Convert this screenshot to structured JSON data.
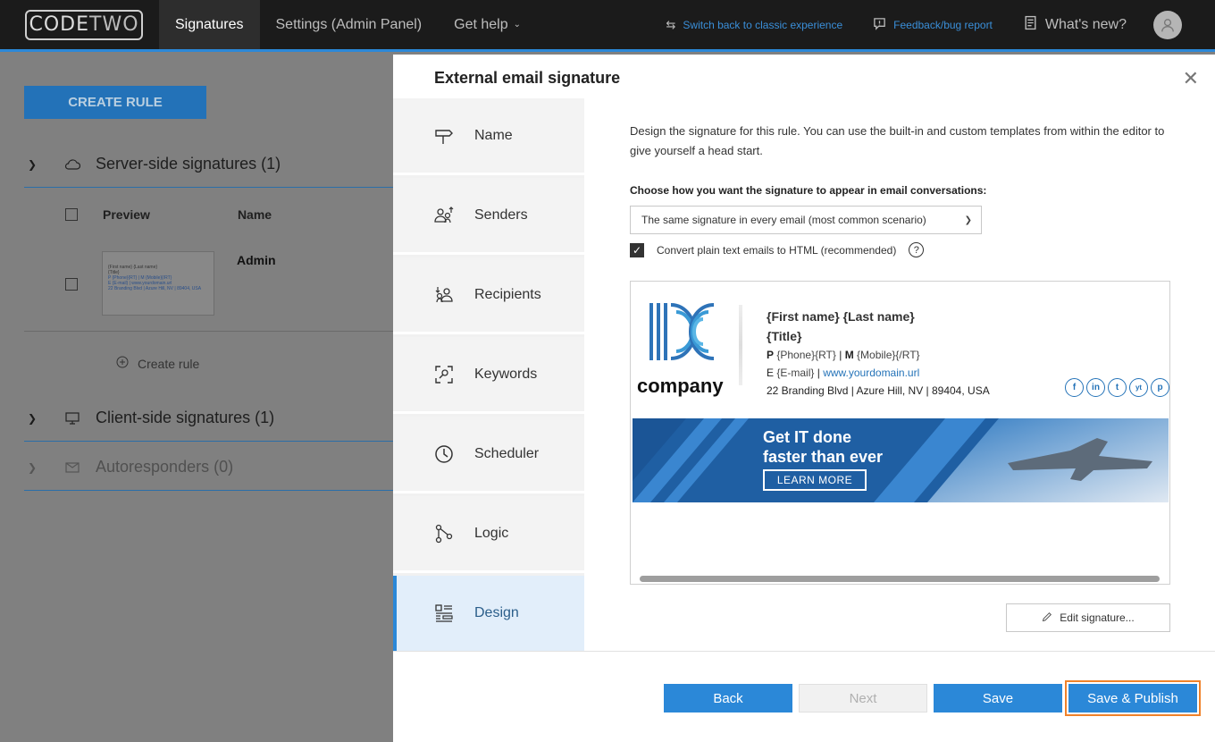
{
  "topbar": {
    "logo_code": "CODE",
    "logo_two": "TWO",
    "nav": [
      {
        "label": "Signatures",
        "active": true
      },
      {
        "label": "Settings (Admin Panel)",
        "active": false
      },
      {
        "label": "Get help",
        "active": false
      }
    ],
    "switch_classic": "Switch back to classic experience",
    "feedback": "Feedback/bug report",
    "whats_new": "What's new?"
  },
  "background": {
    "create_rule_button": "CREATE RULE",
    "sections": [
      {
        "title": "Server-side signatures (1)",
        "expanded": true
      },
      {
        "title": "Client-side signatures (1)",
        "expanded": false
      },
      {
        "title": "Autoresponders (0)",
        "expanded": false
      }
    ],
    "table_headers": {
      "preview": "Preview",
      "name": "Name"
    },
    "row": {
      "name": "Admin",
      "thumb_lines": [
        "{First name} {Last name}",
        "{Title}",
        "P {Phone}{RT} | M {Mobile}{/RT}",
        "E {E-mail} | www.yourdomain.url",
        "22 Branding Blvd | Azure Hill, NV | 89404, USA"
      ]
    },
    "create_rule_link": "Create rule"
  },
  "panel": {
    "title": "External email signature",
    "steps": [
      {
        "label": "Name",
        "icon": "signpost-icon"
      },
      {
        "label": "Senders",
        "icon": "senders-icon"
      },
      {
        "label": "Recipients",
        "icon": "recipients-icon"
      },
      {
        "label": "Keywords",
        "icon": "keywords-icon"
      },
      {
        "label": "Scheduler",
        "icon": "clock-icon"
      },
      {
        "label": "Logic",
        "icon": "logic-icon"
      },
      {
        "label": "Design",
        "icon": "design-icon"
      }
    ],
    "active_step": "Design",
    "intro": "Design the signature for this rule. You can use the built-in and custom templates from within the editor to give yourself a head start.",
    "choose_label": "Choose how you want the signature to appear in email conversations:",
    "select_value": "The same signature in every email (most common scenario)",
    "convert_label": "Convert plain text emails to HTML (recommended)",
    "convert_checked": true,
    "help_glyph": "?",
    "signature": {
      "company": "company",
      "name_line": "{First name} {Last name}",
      "title_line": "{Title}",
      "phone_p": "P",
      "phone_value": "{Phone}{RT}",
      "sep1": "|",
      "mobile_m": "M",
      "mobile_value": "{Mobile}{/RT}",
      "email_e": "E",
      "email_value": "{E-mail}",
      "sep2": "|",
      "url": "www.yourdomain.url",
      "address": "22 Branding Blvd | Azure Hill, NV | 89404, USA",
      "socials": [
        "f",
        "in",
        "t",
        "yt",
        "p"
      ],
      "banner_line1": "Get IT done",
      "banner_line2": "faster than ever",
      "banner_button": "LEARN MORE"
    },
    "edit_signature": "Edit signature...",
    "buttons": {
      "back": "Back",
      "next": "Next",
      "save": "Save",
      "save_publish": "Save & Publish"
    }
  },
  "colors": {
    "accent": "#2b88d8",
    "highlight": "#f0822a",
    "topbar": "#1b1b1b"
  }
}
